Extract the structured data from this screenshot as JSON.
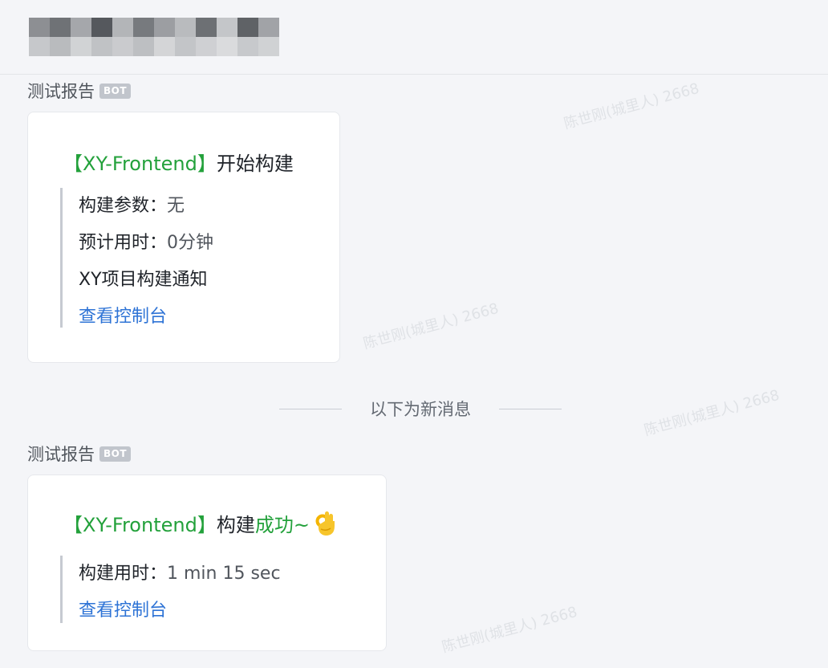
{
  "chat": {
    "mosaic_colors": [
      [
        "#8d8f93",
        "#6f7276",
        "#a5a7ab",
        "#55585d",
        "#b3b5b8",
        "#777a7e",
        "#9c9ea2",
        "#b9bbbe",
        "#6d7074",
        "#c4c6c9",
        "#5f6266",
        "#a1a3a7"
      ],
      [
        "#c6c8cb",
        "#b9bbbe",
        "#d1d3d5",
        "#c0c2c5",
        "#cacbce",
        "#bdbfc2",
        "#d4d5d7",
        "#c3c5c8",
        "#cfd0d3",
        "#dadbdd",
        "#c7c9cc",
        "#d0d2d4"
      ]
    ],
    "new_messages_divider": "以下为新消息",
    "watermark": "陈世刚(城里人) 2668"
  },
  "messages": [
    {
      "sender": "测试报告",
      "badge": "BOT",
      "title_tag": "【XY-Frontend】",
      "title_text": "开始构建",
      "lines": [
        {
          "label": "构建参数：",
          "value": "无"
        },
        {
          "label": "预计用时：",
          "value": "0分钟"
        }
      ],
      "note": "XY项目构建通知",
      "link": "查看控制台"
    },
    {
      "sender": "测试报告",
      "badge": "BOT",
      "title_tag": "【XY-Frontend】",
      "title_text": "构建",
      "title_success": "成功~",
      "title_icon": "ok-hand-icon",
      "lines": [
        {
          "label": "构建用时：",
          "value": "1 min 15 sec"
        }
      ],
      "link": "查看控制台"
    }
  ]
}
